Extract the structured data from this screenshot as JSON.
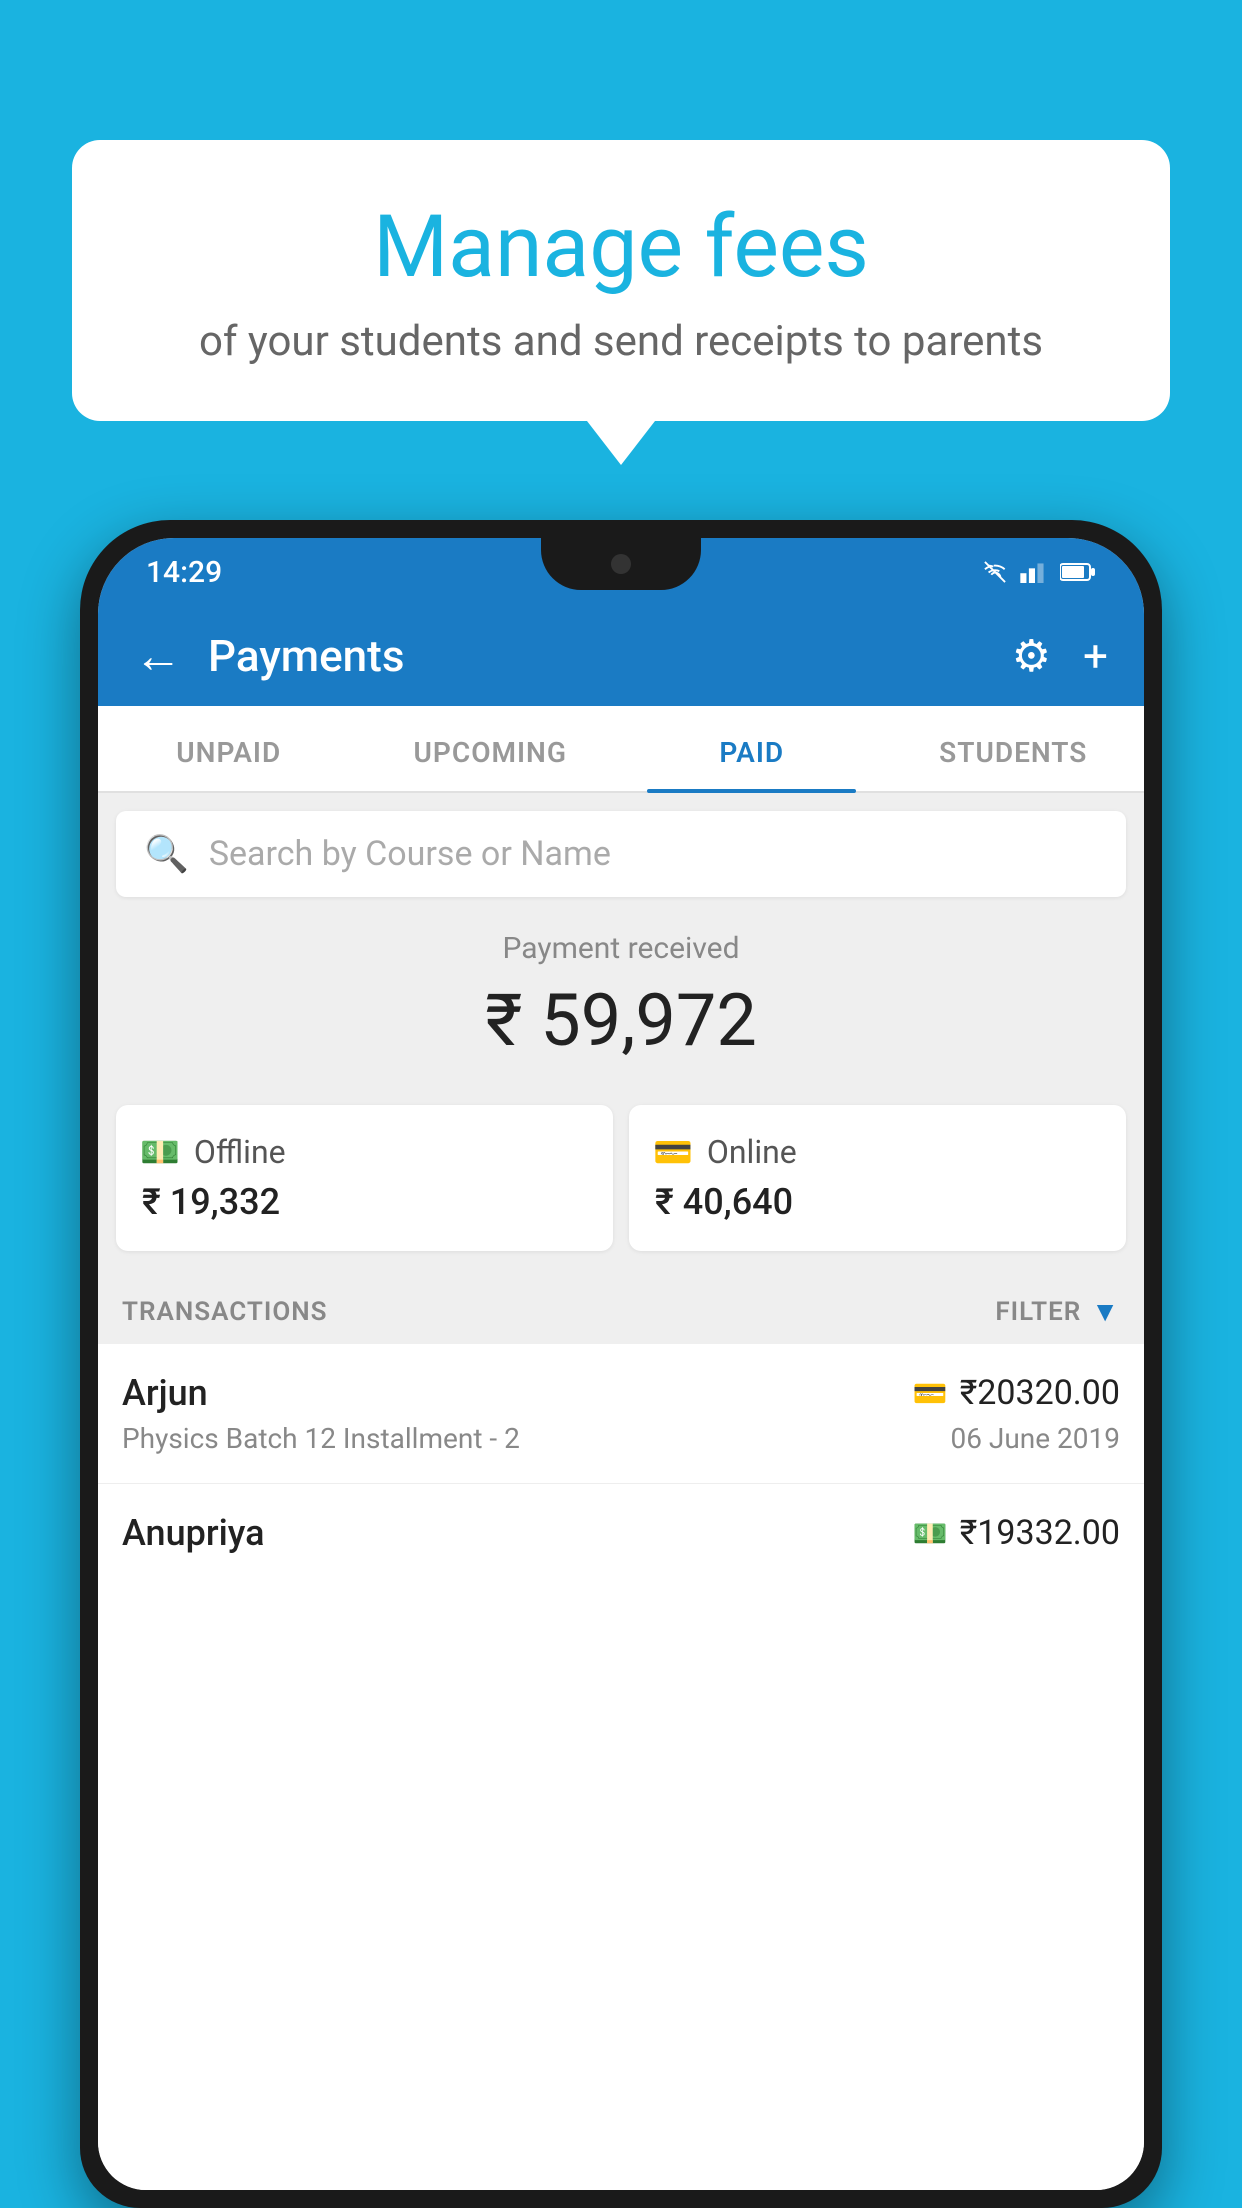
{
  "background_color": "#1ab3e0",
  "bubble": {
    "title": "Manage fees",
    "subtitle": "of your students and send receipts to parents"
  },
  "status_bar": {
    "time": "14:29"
  },
  "app_bar": {
    "title": "Payments",
    "back_label": "←",
    "settings_label": "⚙",
    "add_label": "+"
  },
  "tabs": [
    {
      "label": "UNPAID",
      "active": false
    },
    {
      "label": "UPCOMING",
      "active": false
    },
    {
      "label": "PAID",
      "active": true
    },
    {
      "label": "STUDENTS",
      "active": false
    }
  ],
  "search": {
    "placeholder": "Search by Course or Name"
  },
  "payment_summary": {
    "label": "Payment received",
    "amount": "₹ 59,972",
    "offline": {
      "label": "Offline",
      "amount": "₹ 19,332"
    },
    "online": {
      "label": "Online",
      "amount": "₹ 40,640"
    }
  },
  "transactions": {
    "header_label": "TRANSACTIONS",
    "filter_label": "FILTER",
    "items": [
      {
        "name": "Arjun",
        "amount": "₹20320.00",
        "detail": "Physics Batch 12 Installment - 2",
        "date": "06 June 2019",
        "payment_method": "card"
      },
      {
        "name": "Anupriya",
        "amount": "₹19332.00",
        "detail": "",
        "date": "",
        "payment_method": "cash"
      }
    ]
  }
}
